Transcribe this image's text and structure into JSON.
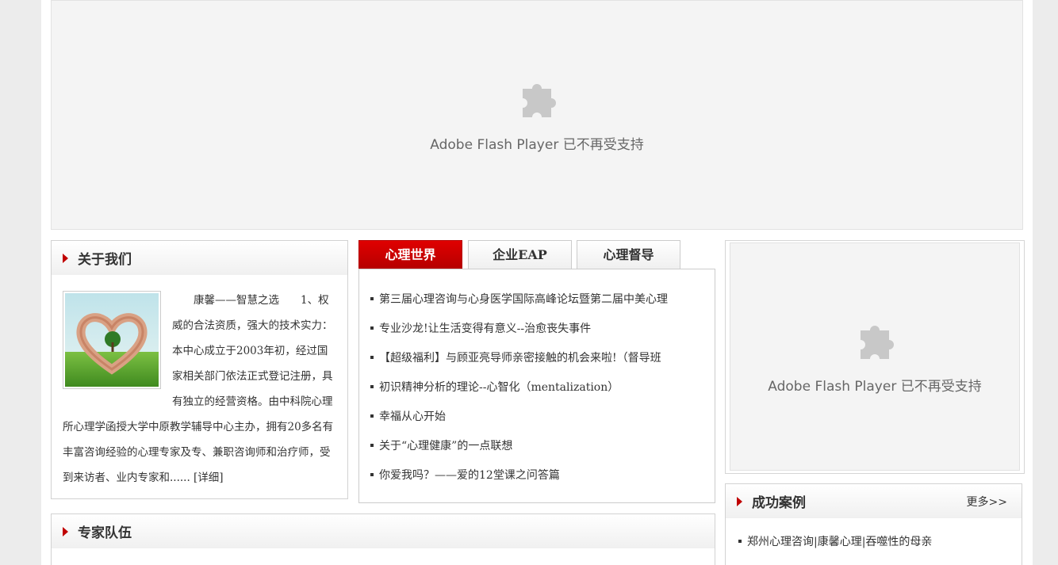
{
  "flash_top": {
    "message": "Adobe Flash Player 已不再受支持",
    "icon": "puzzle-icon"
  },
  "flash_right": {
    "message": "Adobe Flash Player 已不再受支持",
    "icon": "puzzle-icon"
  },
  "about": {
    "title": "关于我们",
    "text": "　　康馨——智慧之选　　1、权威的合法资质，强大的技术实力：　　　本中心成立于2003年初，经过国家相关部门依法正式登记注册，具有独立的经营资格。由中科院心理所心理学函授大学中原教学辅导中心主办，拥有20多名有丰富咨询经验的心理专家及专、兼职咨询师和治疗师，受到来访者、业内专家和...... [详细]"
  },
  "tabs": [
    {
      "label": "心理世界",
      "active": true
    },
    {
      "label": "企业EAP",
      "active": false
    },
    {
      "label": "心理督导",
      "active": false
    }
  ],
  "news": [
    "第三届心理咨询与心身医学国际高峰论坛暨第二届中美心理",
    "专业沙龙!让生活变得有意义--治愈丧失事件",
    "【超级福利】与顾亚亮导师亲密接触的机会来啦!（督导班",
    "初识精神分析的理论--心智化（mentalization）",
    "幸福从心开始",
    "关于“心理健康”的一点联想",
    "你爱我吗？——爱的12堂课之问答篇"
  ],
  "experts": {
    "title": "专家队伍"
  },
  "cases": {
    "title": "成功案例",
    "more": "更多>>",
    "items": [
      "郑州心理咨询|康馨心理|吞噬性的母亲"
    ]
  },
  "colors": {
    "accent": "#c00000",
    "tab_active": "#d00000"
  }
}
